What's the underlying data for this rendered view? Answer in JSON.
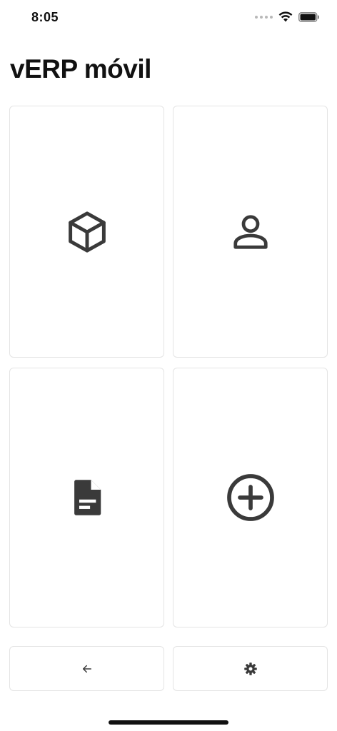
{
  "status_bar": {
    "time": "8:05"
  },
  "header": {
    "title": "vERP móvil"
  },
  "tiles": [
    {
      "icon": "cube-icon"
    },
    {
      "icon": "person-icon"
    },
    {
      "icon": "document-icon"
    },
    {
      "icon": "add-circle-icon"
    }
  ],
  "bottom_buttons": [
    {
      "icon": "arrow-left-icon"
    },
    {
      "icon": "gear-icon"
    }
  ],
  "colors": {
    "icon": "#3a3a3a",
    "border": "#e4e4e4",
    "background": "#ffffff",
    "text": "#111111"
  }
}
